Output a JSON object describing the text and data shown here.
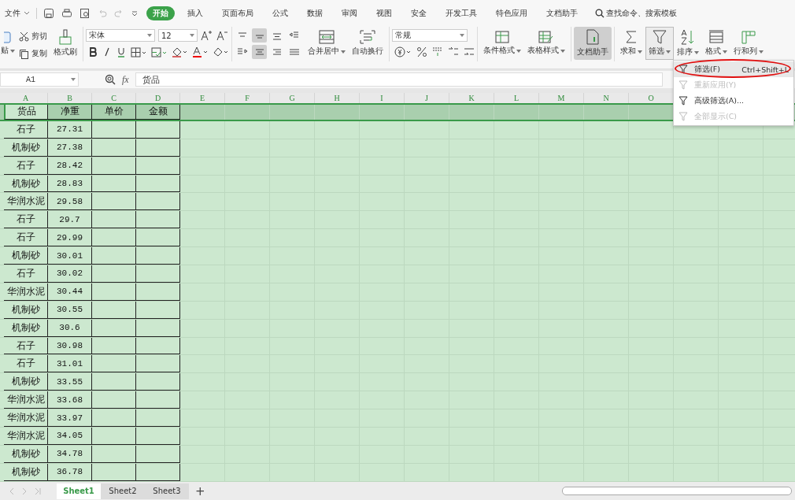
{
  "menu_bar": {
    "file": "文件",
    "tabs": [
      {
        "label": "开始",
        "selected": true
      },
      {
        "label": "插入",
        "selected": false
      },
      {
        "label": "页面布局",
        "selected": false
      },
      {
        "label": "公式",
        "selected": false
      },
      {
        "label": "数据",
        "selected": false
      },
      {
        "label": "审阅",
        "selected": false
      },
      {
        "label": "视图",
        "selected": false
      },
      {
        "label": "安全",
        "selected": false
      },
      {
        "label": "开发工具",
        "selected": false
      },
      {
        "label": "特色应用",
        "selected": false
      },
      {
        "label": "文档助手",
        "selected": false
      }
    ],
    "search": "查找命令、搜索模板"
  },
  "ribbon": {
    "paste": "贴",
    "cut": "剪切",
    "copy": "复制",
    "format_painter": "格式刷",
    "font": "宋体",
    "font_size": "12",
    "align_buttons": [
      {
        "selected": false
      },
      {
        "selected": true
      },
      {
        "selected": false
      },
      {
        "selected": false
      },
      {
        "selected": false
      },
      {
        "selected": true
      },
      {
        "selected": false
      },
      {
        "selected": false
      }
    ],
    "merge": "合并居中",
    "wrap": "自动换行",
    "number_format": "常规",
    "conditional": "条件格式",
    "table_style": "表格样式",
    "assistant": "文档助手",
    "assistant_active": true,
    "sum": "求和",
    "filter": "筛选",
    "filter_open": true,
    "sort": "排序",
    "format": "格式",
    "rows_cols": "行和列"
  },
  "formula_bar": {
    "name_box": "A1",
    "fx": "fx",
    "value": "货品"
  },
  "sheet": {
    "columns": [
      "A",
      "B",
      "C",
      "D",
      "E",
      "F",
      "G",
      "H",
      "I",
      "J",
      "K",
      "L",
      "M",
      "N",
      "O"
    ],
    "header": [
      "货品",
      "净重",
      "单价",
      "金额"
    ],
    "rows": [
      [
        "石子",
        "27.31"
      ],
      [
        "机制砂",
        "27.38"
      ],
      [
        "石子",
        "28.42"
      ],
      [
        "机制砂",
        "28.83"
      ],
      [
        "华润水泥",
        "29.58"
      ],
      [
        "石子",
        "29.7"
      ],
      [
        "石子",
        "29.99"
      ],
      [
        "机制砂",
        "30.01"
      ],
      [
        "石子",
        "30.02"
      ],
      [
        "华润水泥",
        "30.44"
      ],
      [
        "机制砂",
        "30.55"
      ],
      [
        "机制砂",
        "30.6"
      ],
      [
        "石子",
        "30.98"
      ],
      [
        "石子",
        "31.01"
      ],
      [
        "机制砂",
        "33.55"
      ],
      [
        "华润水泥",
        "33.68"
      ],
      [
        "华润水泥",
        "33.97"
      ],
      [
        "华润水泥",
        "34.05"
      ],
      [
        "机制砂",
        "34.78"
      ],
      [
        "机制砂",
        "36.78"
      ]
    ]
  },
  "filter_menu": {
    "items": [
      {
        "label": "筛选(F)",
        "shortcut": "Ctrl+Shift+L",
        "disabled": false,
        "highlighted": true
      },
      {
        "label": "重新应用(Y)",
        "disabled": true,
        "highlighted": false
      },
      {
        "label": "高级筛选(A)...",
        "disabled": false,
        "highlighted": false
      },
      {
        "label": "全部显示(C)",
        "disabled": true,
        "highlighted": false
      }
    ]
  },
  "sheet_tabs": [
    {
      "label": "Sheet1",
      "selected": true
    },
    {
      "label": "Sheet2",
      "selected": false
    },
    {
      "label": "Sheet3",
      "selected": false
    }
  ],
  "add_sheet": "+"
}
